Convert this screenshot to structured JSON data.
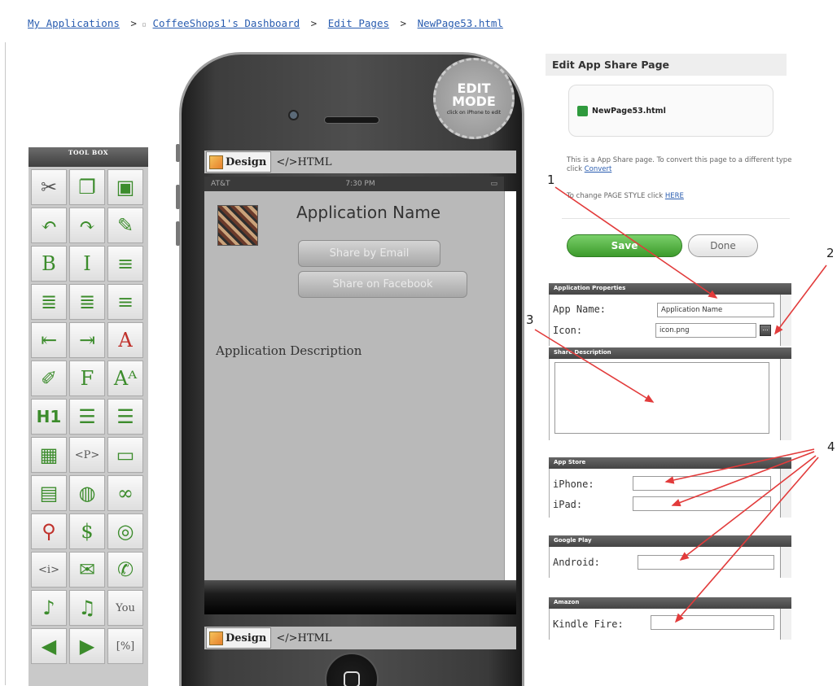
{
  "breadcrumb": {
    "items": [
      "My Applications",
      "CoffeeShops1's Dashboard",
      "Edit Pages",
      "NewPage53.html"
    ],
    "separator": ">"
  },
  "toolbox": {
    "title": "TOOL BOX",
    "tools": [
      {
        "glyph": "✂",
        "icon": "cut-icon",
        "tone": "dark"
      },
      {
        "glyph": "❐",
        "icon": "copy-icon",
        "tone": "green"
      },
      {
        "glyph": "▣",
        "icon": "paste-icon",
        "tone": "green"
      },
      {
        "glyph": "↶",
        "icon": "undo-icon",
        "tone": "green"
      },
      {
        "glyph": "↷",
        "icon": "redo-icon",
        "tone": "green"
      },
      {
        "glyph": "✎",
        "icon": "eraser-icon",
        "tone": "green"
      },
      {
        "glyph": "B",
        "icon": "bold-icon",
        "tone": "green"
      },
      {
        "glyph": "I",
        "icon": "italic-icon",
        "tone": "green"
      },
      {
        "glyph": "≡",
        "icon": "align-left-icon",
        "tone": "green"
      },
      {
        "glyph": "≣",
        "icon": "align-center-icon",
        "tone": "green"
      },
      {
        "glyph": "≣",
        "icon": "align-right-icon",
        "tone": "green"
      },
      {
        "glyph": "≡",
        "icon": "justify-icon",
        "tone": "green"
      },
      {
        "glyph": "⇤",
        "icon": "outdent-icon",
        "tone": "green"
      },
      {
        "glyph": "⇥",
        "icon": "indent-icon",
        "tone": "green"
      },
      {
        "glyph": "A",
        "icon": "font-color-icon",
        "tone": "red"
      },
      {
        "glyph": "✐",
        "icon": "highlight-icon",
        "tone": "green"
      },
      {
        "glyph": "F",
        "icon": "font-icon",
        "tone": "green"
      },
      {
        "glyph": "Aᴬ",
        "icon": "font-size-icon",
        "tone": "green"
      },
      {
        "glyph": "H1",
        "icon": "heading-icon",
        "tone": "h1"
      },
      {
        "glyph": "☰",
        "icon": "unordered-list-icon",
        "tone": "green"
      },
      {
        "glyph": "☰",
        "icon": "ordered-list-icon",
        "tone": "green"
      },
      {
        "glyph": "▦",
        "icon": "table-icon",
        "tone": "green"
      },
      {
        "glyph": "<P>",
        "icon": "paragraph-icon",
        "tone": "small"
      },
      {
        "glyph": "▭",
        "icon": "image-icon",
        "tone": "green"
      },
      {
        "glyph": "▤",
        "icon": "page-link-icon",
        "tone": "green"
      },
      {
        "glyph": "◍",
        "icon": "web-link-icon",
        "tone": "green"
      },
      {
        "glyph": "∞",
        "icon": "link-icon",
        "tone": "green"
      },
      {
        "glyph": "⚲",
        "icon": "map-icon",
        "tone": "red"
      },
      {
        "glyph": "$",
        "icon": "payment-icon",
        "tone": "green"
      },
      {
        "glyph": "◎",
        "icon": "rss-icon",
        "tone": "green"
      },
      {
        "glyph": "<i>",
        "icon": "info-icon",
        "tone": "small"
      },
      {
        "glyph": "✉",
        "icon": "email-icon",
        "tone": "green"
      },
      {
        "glyph": "✆",
        "icon": "phone-icon",
        "tone": "green"
      },
      {
        "glyph": "♪",
        "icon": "mp3-icon",
        "tone": "green"
      },
      {
        "glyph": "♫",
        "icon": "audio-link-icon",
        "tone": "green"
      },
      {
        "glyph": "You",
        "icon": "youtube-icon",
        "tone": "small"
      },
      {
        "glyph": "◀",
        "icon": "wav-icon",
        "tone": "green"
      },
      {
        "glyph": "▶",
        "icon": "video-icon",
        "tone": "green"
      },
      {
        "glyph": "[%]",
        "icon": "variable-icon",
        "tone": "small"
      }
    ]
  },
  "phone": {
    "edit_badge": {
      "line1": "EDIT",
      "line2": "MODE",
      "hint": "click on iPhone to edit"
    },
    "design_tab": "Design",
    "html_tab": "</>HTML",
    "status": {
      "carrier": "AT&T",
      "time": "7:30 PM"
    },
    "app_name": "Application Name",
    "share_email": "Share by Email",
    "share_facebook": "Share on Facebook",
    "app_description": "Application Description"
  },
  "panel": {
    "title": "Edit App Share Page",
    "file_name": "NewPage53.html",
    "info1_pre": "This is a App Share page. To convert this page to a different type click",
    "info1_link": "Convert",
    "info2_pre": "To change PAGE STYLE click",
    "info2_link": "HERE",
    "save_label": "Save",
    "done_label": "Done",
    "app_props": {
      "header": "Application Properties",
      "app_name_label": "App Name:",
      "app_name_value": "Application Name",
      "icon_label": "Icon:",
      "icon_value": "icon.png",
      "browse_label": "..."
    },
    "share_desc": {
      "header": "Share Description"
    },
    "app_store": {
      "header": "App Store",
      "iphone_label": "iPhone:",
      "ipad_label": "iPad:"
    },
    "google_play": {
      "header": "Google Play",
      "android_label": "Android:"
    },
    "amazon": {
      "header": "Amazon",
      "kindle_label": "Kindle Fire:"
    }
  },
  "annotations": [
    "1",
    "2",
    "3",
    "4"
  ],
  "colors": {
    "arrow": "#e23b3b",
    "save_green": "#3c9a2b",
    "link_blue": "#2a5db0"
  }
}
